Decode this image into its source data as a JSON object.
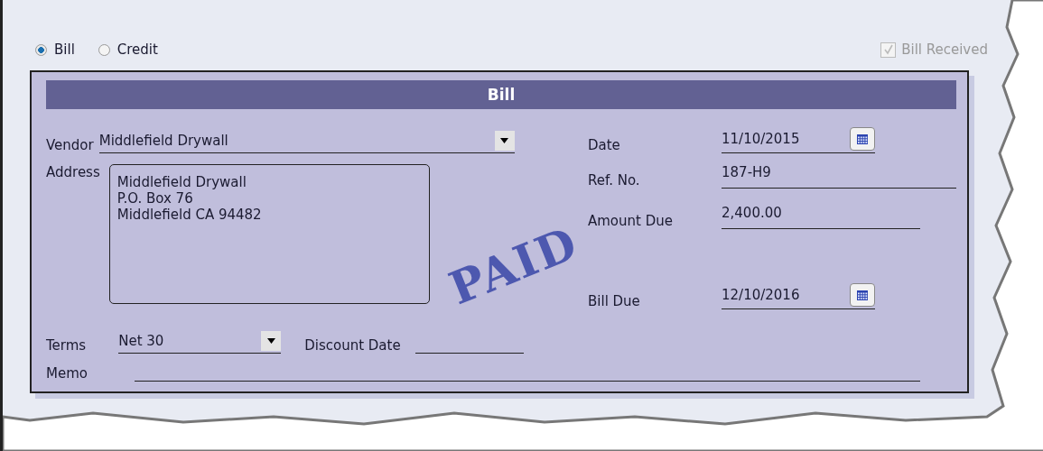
{
  "type_options": [
    {
      "label": "Bill",
      "selected": true
    },
    {
      "label": "Credit",
      "selected": false
    }
  ],
  "bill_received": {
    "label": "Bill Received",
    "checked": true,
    "disabled": true
  },
  "form": {
    "title": "Bill",
    "vendor": {
      "label": "Vendor",
      "value": "Middlefield Drywall"
    },
    "address": {
      "label": "Address",
      "lines": [
        "Middlefield Drywall",
        "P.O. Box 76",
        "Middlefield CA 94482"
      ]
    },
    "terms": {
      "label": "Terms",
      "value": "Net 30"
    },
    "discount_date": {
      "label": "Discount Date"
    },
    "memo": {
      "label": "Memo"
    },
    "date": {
      "label": "Date",
      "value": "11/10/2015"
    },
    "ref_no": {
      "label": "Ref. No.",
      "value": "187-H9"
    },
    "amount_due": {
      "label": "Amount Due",
      "value": "2,400.00"
    },
    "bill_due": {
      "label": "Bill Due",
      "value": "12/10/2016"
    },
    "stamp": {
      "text": "PAID"
    }
  }
}
